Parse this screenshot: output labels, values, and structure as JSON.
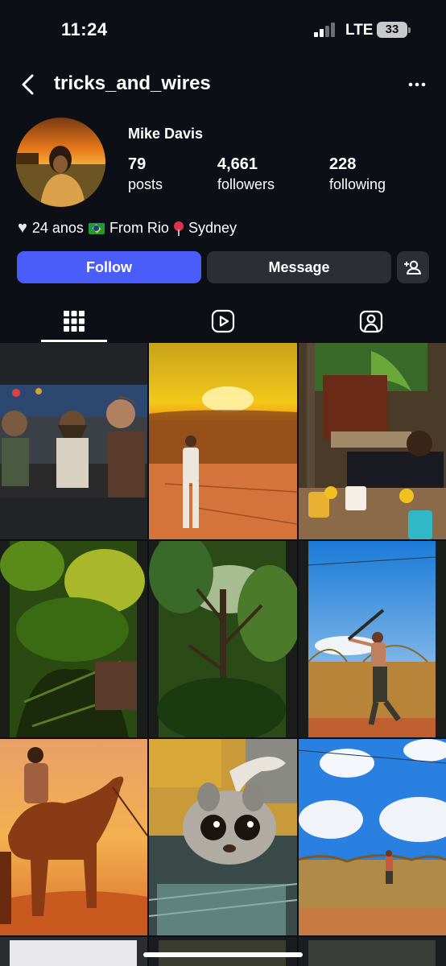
{
  "status_bar": {
    "time": "11:24",
    "network": "LTE",
    "battery": "33"
  },
  "header": {
    "username": "tricks_and_wires"
  },
  "profile": {
    "name": "Mike Davis",
    "stats": [
      {
        "value": "79",
        "label": "posts"
      },
      {
        "value": "4,661",
        "label": "followers"
      },
      {
        "value": "228",
        "label": "following"
      }
    ],
    "bio": {
      "age": "24 anos",
      "from": "From Rio",
      "location": "Sydney"
    }
  },
  "actions": {
    "follow": "Follow",
    "message": "Message"
  },
  "tabs": [
    {
      "icon": "grid-icon",
      "selected": true
    },
    {
      "icon": "reels-icon",
      "selected": false
    },
    {
      "icon": "tagged-icon",
      "selected": false
    }
  ],
  "grid_posts": [
    "group-selfie-bar",
    "desert-sunset",
    "table-outdoor",
    "jungle-plants",
    "forest-canopy",
    "man-swinging",
    "camel-rider",
    "bushbaby-animal",
    "field-sky"
  ],
  "colors": {
    "follow": "#4a5df9",
    "secondary_button": "#2b2e35",
    "background": "#0c0f16"
  }
}
